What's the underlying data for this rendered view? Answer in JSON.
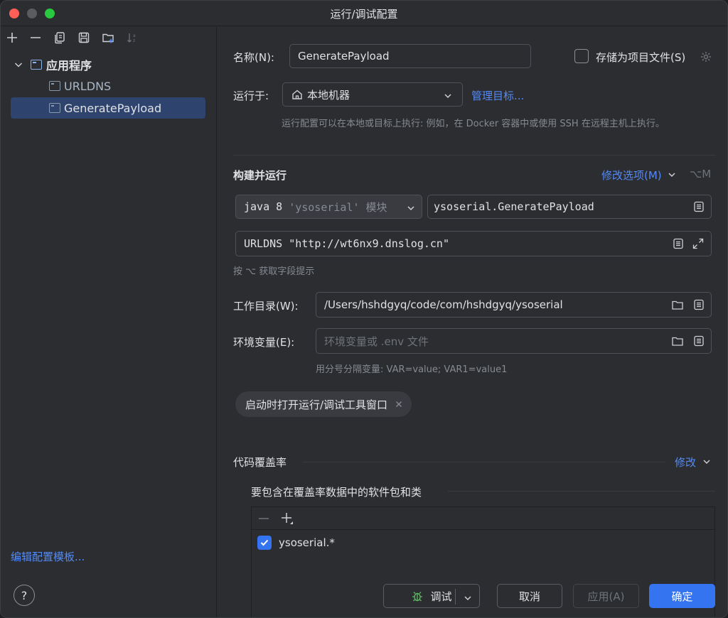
{
  "window": {
    "title": "运行/调试配置"
  },
  "sidebar": {
    "tree": {
      "group_label": "应用程序",
      "items": [
        {
          "label": "URLDNS"
        },
        {
          "label": "GeneratePayload"
        }
      ]
    },
    "edit_templates_label": "编辑配置模板...",
    "help_label": "?"
  },
  "form": {
    "name_label": "名称(N):",
    "name_value": "GeneratePayload",
    "store_as_file_label": "存储为项目文件(S)",
    "run_on_label": "运行于:",
    "run_on_value": "本地机器",
    "manage_targets_label": "管理目标...",
    "run_on_hint": "运行配置可以在本地或目标上执行: 例如，在 Docker 容器中或使用 SSH 在远程主机上执行。",
    "build_run_title": "构建并运行",
    "modify_options_label": "修改选项(M)",
    "modify_options_shortcut": "⌥M",
    "jdk_value": "java 8",
    "jdk_module": "'ysoserial' 模块",
    "main_class_value": "ysoserial.GeneratePayload",
    "program_args_value": "URLDNS \"http://wt6nx9.dnslog.cn\"",
    "field_hint": "按 ⌥ 获取字段提示",
    "workdir_label": "工作目录(W):",
    "workdir_value": "/Users/hshdgyq/code/com/hshdgyq/ysoserial",
    "env_label": "环境变量(E):",
    "env_placeholder": "环境变量或 .env 文件",
    "env_hint": "用分号分隔变量: VAR=value; VAR1=value1",
    "chip_label": "启动时打开运行/调试工具窗口",
    "coverage_title": "代码覆盖率",
    "coverage_modify_label": "修改",
    "coverage_include_label": "要包含在覆盖率数据中的软件包和类",
    "coverage_items": [
      {
        "label": "ysoserial.*",
        "checked": true
      }
    ]
  },
  "buttons": {
    "debug_label": "调试",
    "cancel_label": "取消",
    "apply_label": "应用(A)",
    "ok_label": "确定"
  },
  "colors": {
    "accent": "#3574f0",
    "link": "#548af7",
    "background": "#2b2d30",
    "debug_icon": "#5fb865"
  }
}
